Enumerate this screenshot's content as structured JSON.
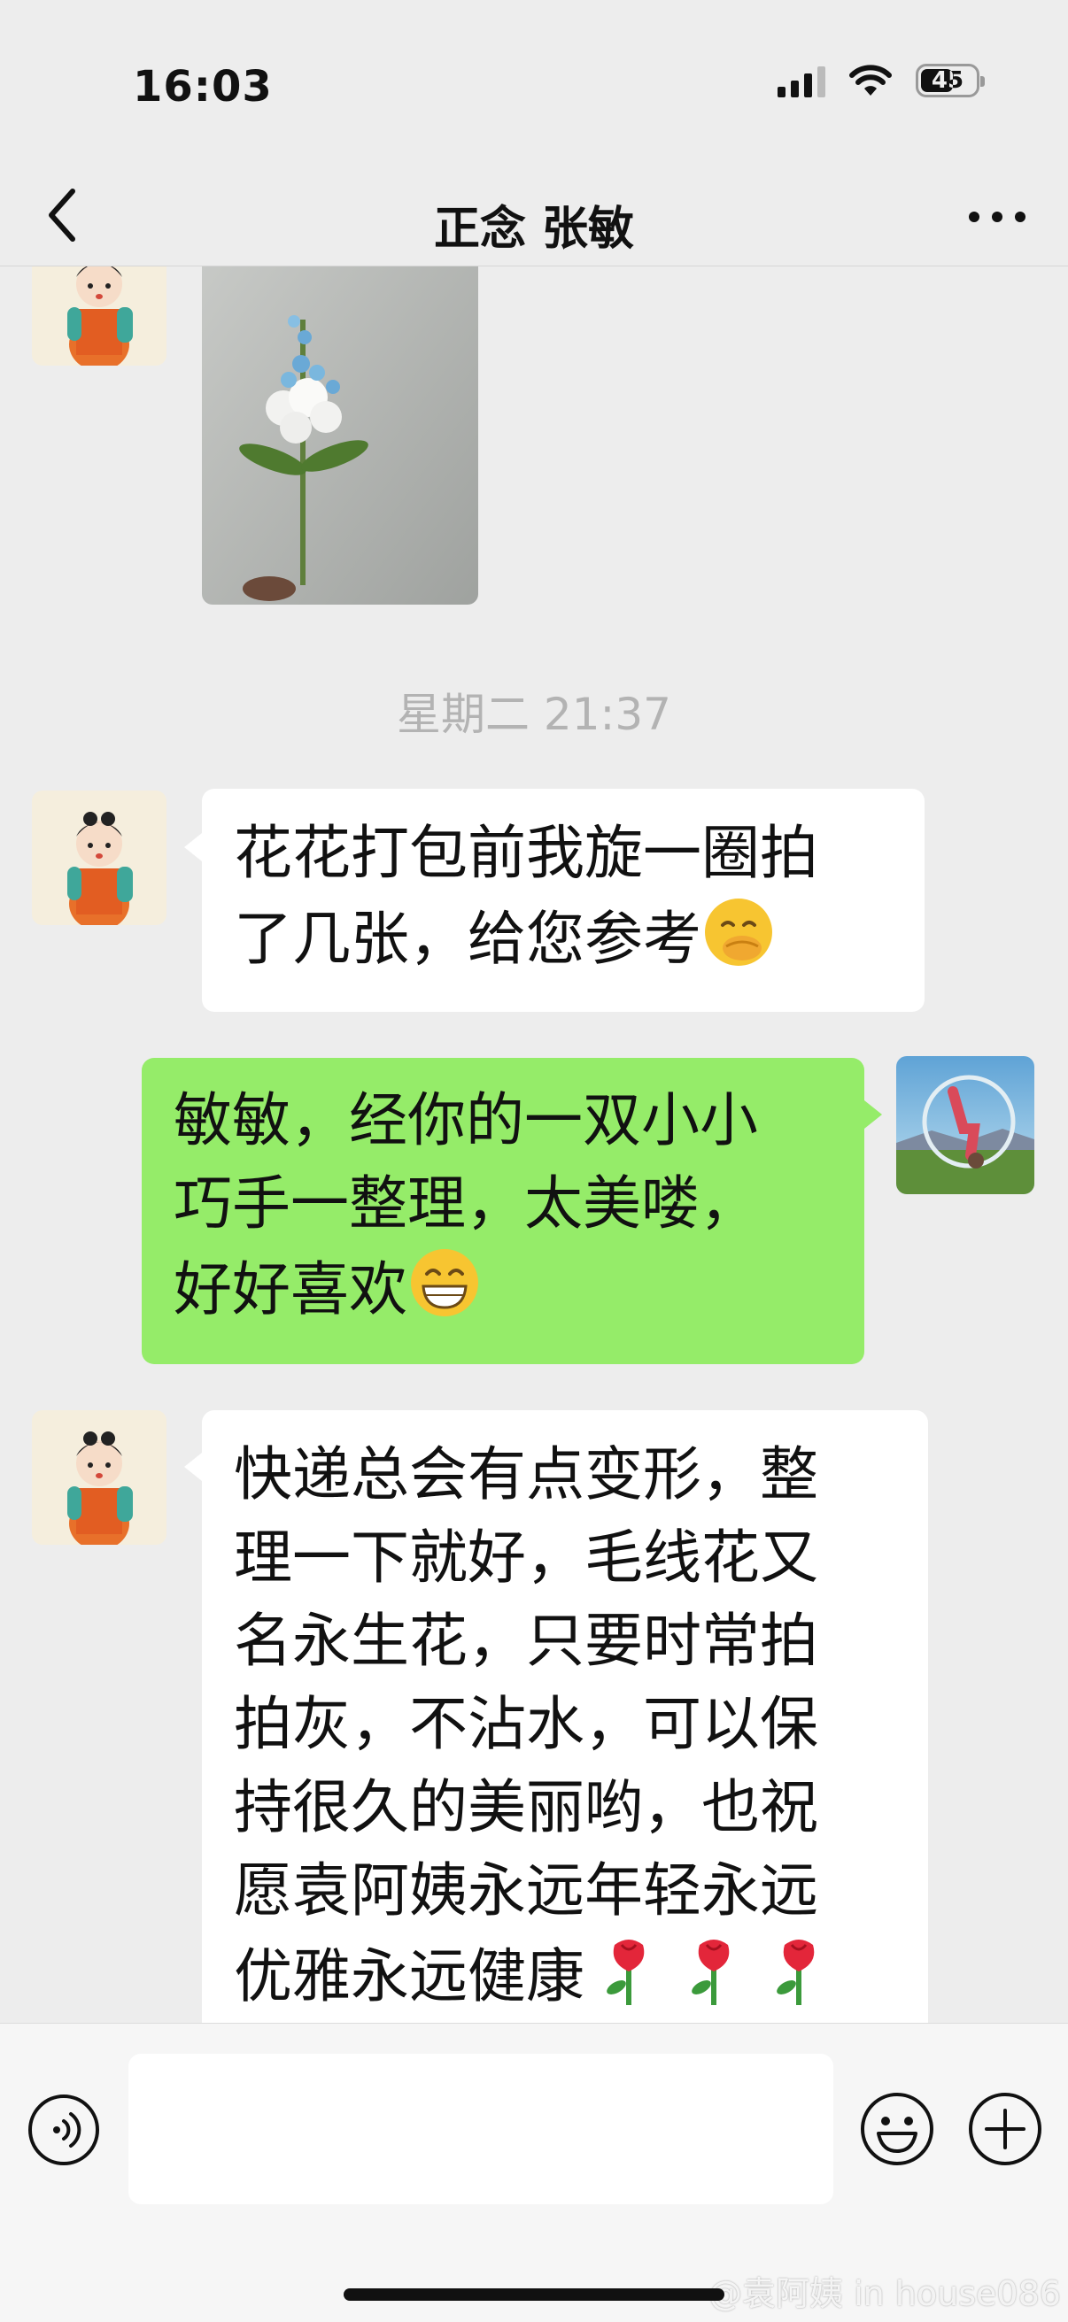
{
  "status_bar": {
    "time": "16:03",
    "battery_level": "45"
  },
  "nav": {
    "title": "正念 张敏"
  },
  "messages": [
    {
      "side": "left",
      "type": "image"
    },
    {
      "type": "timestamp",
      "text": "星期二 21:37"
    },
    {
      "side": "left",
      "type": "text",
      "line1": "花花打包前我旋一圈拍",
      "line2": "了几张，给您参考",
      "emoji": "face-with-hand-over-mouth"
    },
    {
      "side": "right",
      "type": "text",
      "line1": "敏敏，经你的一双小小",
      "line2": "巧手一整理，太美喽，",
      "line3": "好好喜欢",
      "emoji": "grinning-face"
    },
    {
      "side": "left",
      "type": "text",
      "line1": "快递总会有点变形，整",
      "line2": "理一下就好，毛线花又",
      "line3": "名永生花，只要时常拍",
      "line4": "拍灰，不沾水，可以保",
      "line5": "持很久的美丽哟，也祝",
      "line6": "愿袁阿姨永远年轻永远",
      "line7": "优雅永远健康",
      "emoji": "rose"
    }
  ],
  "watermark": "@袁阿姨 in house086",
  "colors": {
    "background": "#ededed",
    "bubble_self": "#95ec69",
    "bubble_other": "#ffffff",
    "timestamp": "#b3b3b3"
  }
}
